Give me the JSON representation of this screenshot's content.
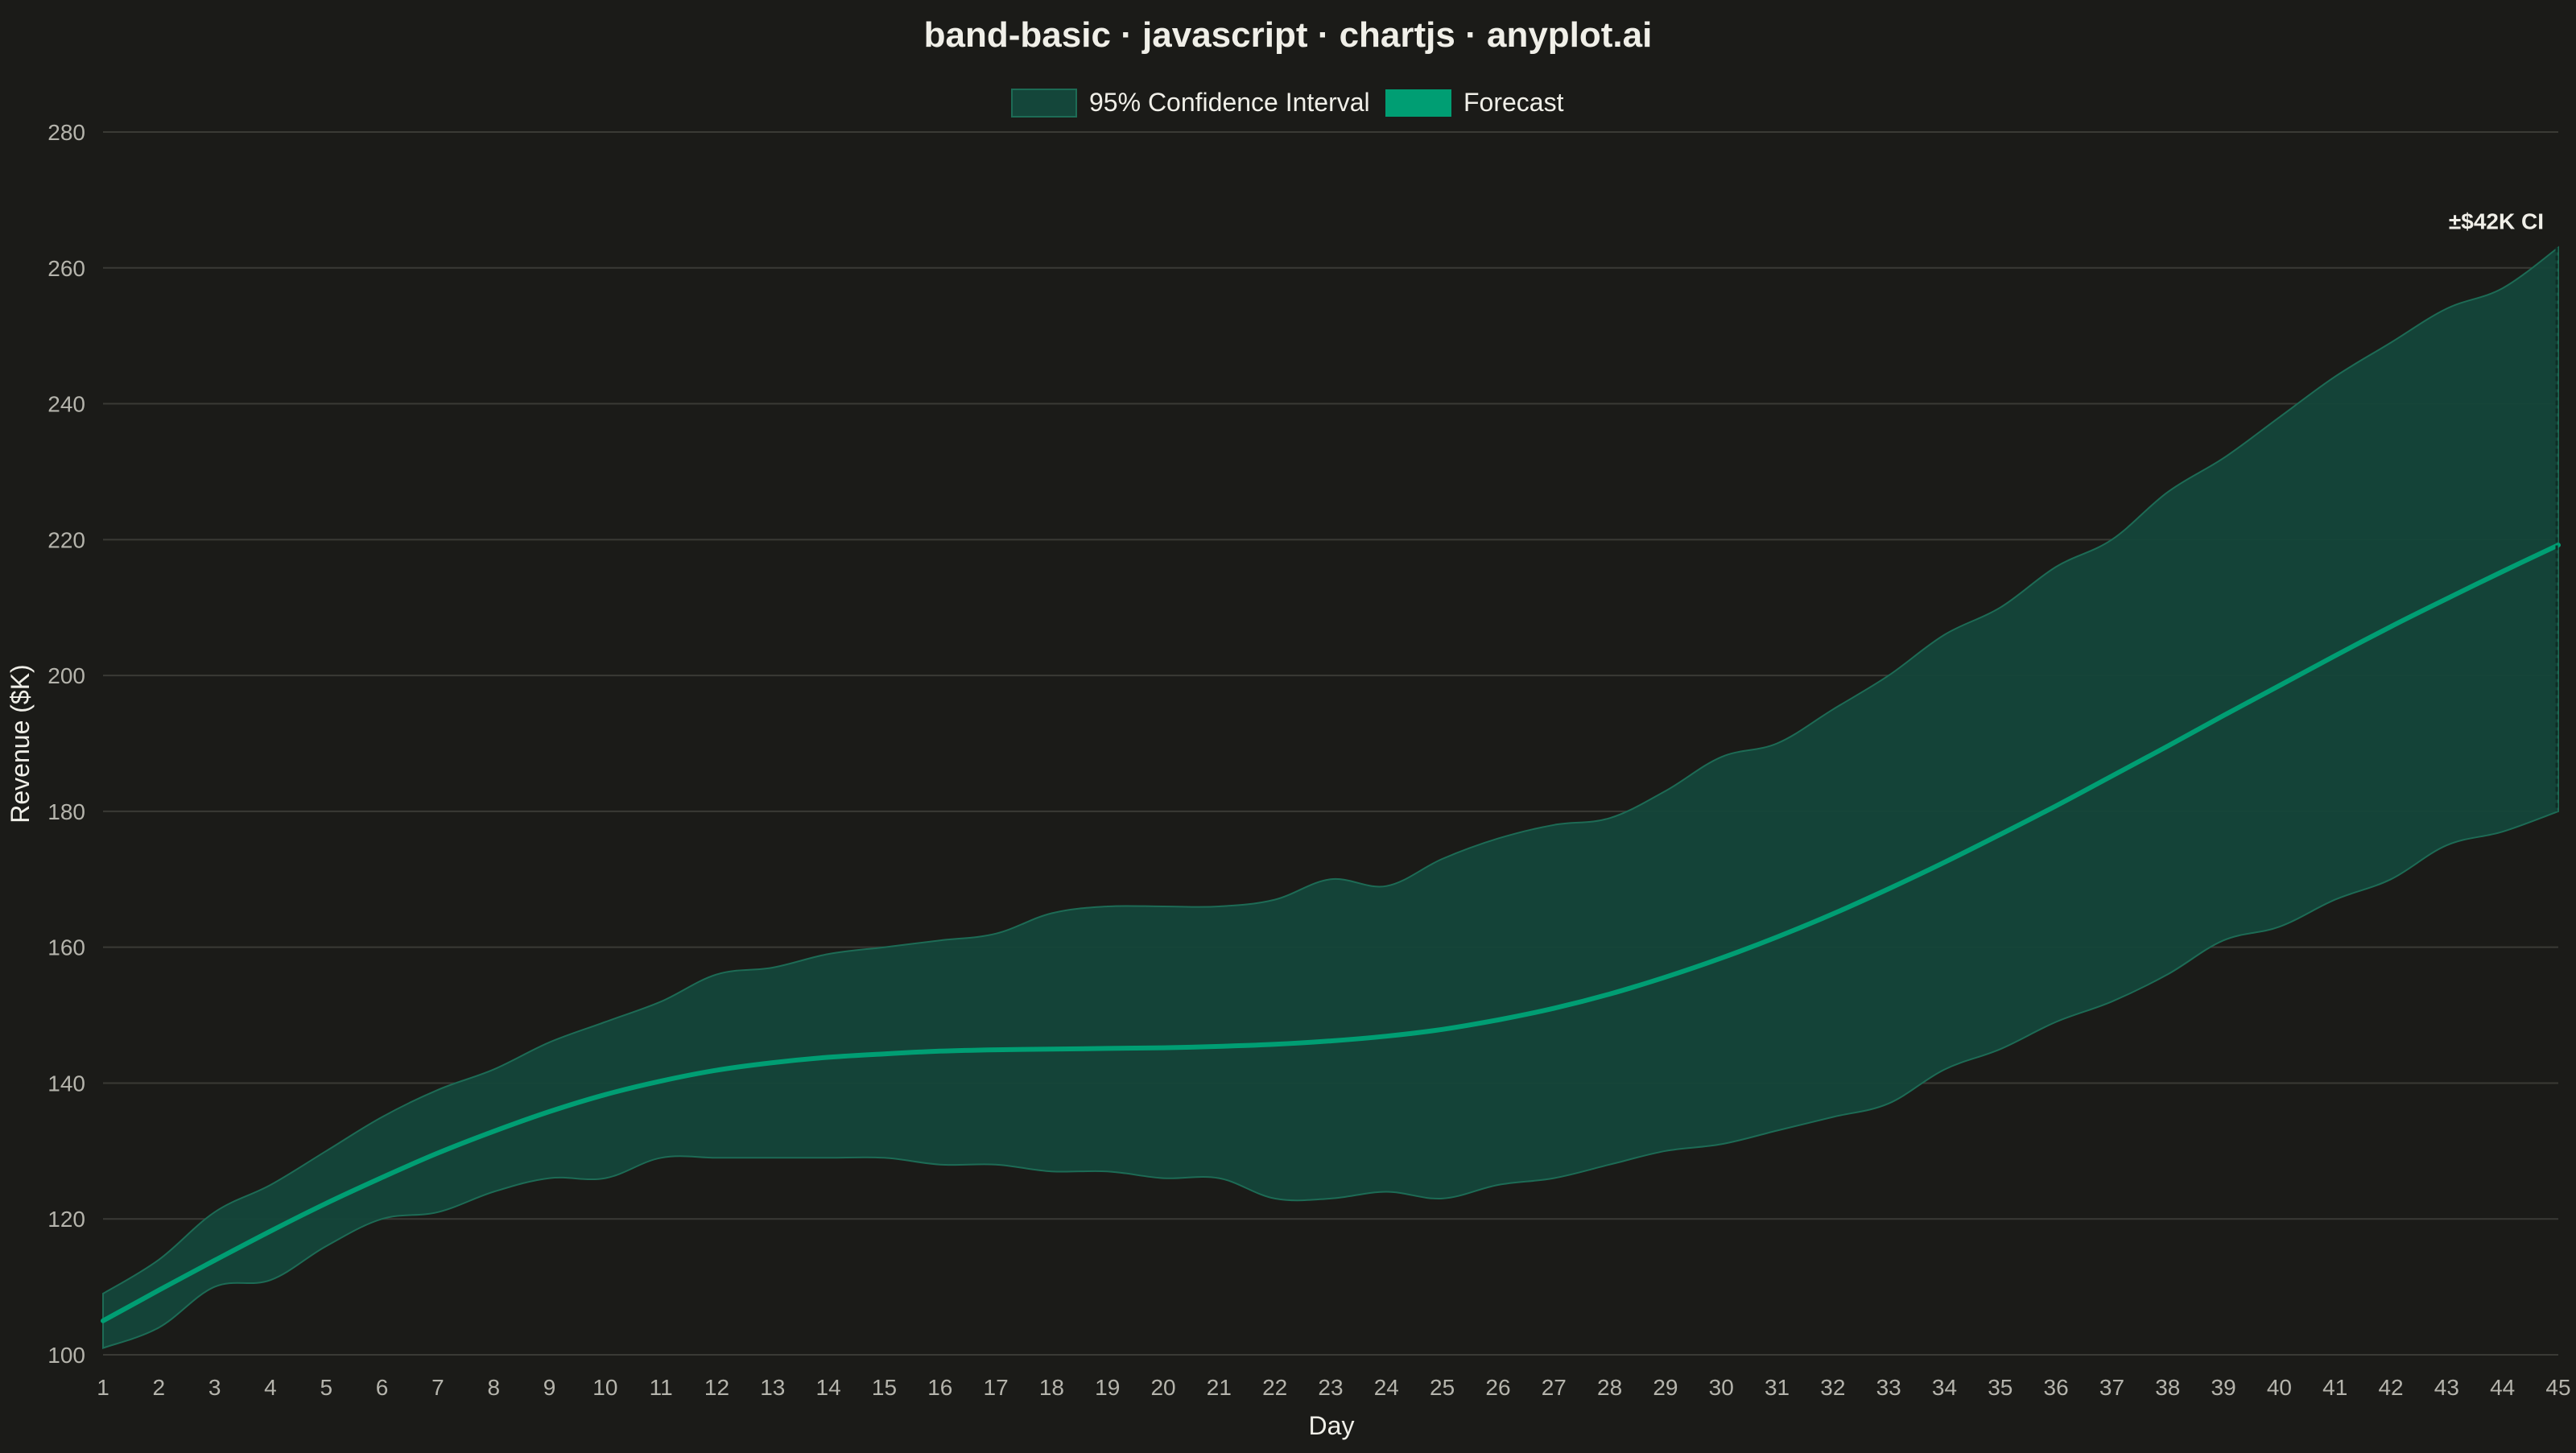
{
  "chart_data": {
    "type": "area",
    "title": "band-basic · javascript · chartjs · anyplot.ai",
    "xlabel": "Day",
    "ylabel": "Revenue ($K)",
    "ylim": [
      100,
      280
    ],
    "yticks": [
      100,
      120,
      140,
      160,
      180,
      200,
      220,
      240,
      260,
      280
    ],
    "grid": true,
    "legend_position": "top-center",
    "x": [
      1,
      2,
      3,
      4,
      5,
      6,
      7,
      8,
      9,
      10,
      11,
      12,
      13,
      14,
      15,
      16,
      17,
      18,
      19,
      20,
      21,
      22,
      23,
      24,
      25,
      26,
      27,
      28,
      29,
      30,
      31,
      32,
      33,
      34,
      35,
      36,
      37,
      38,
      39,
      40,
      41,
      42,
      43,
      44,
      45
    ],
    "series": [
      {
        "name": "95% Confidence Interval",
        "kind": "band",
        "upper": [
          109,
          114,
          121,
          125,
          130,
          135,
          139,
          142,
          146,
          149,
          152,
          156,
          157,
          159,
          160,
          161,
          162,
          165,
          166,
          166,
          166,
          167,
          170,
          169,
          173,
          176,
          178,
          179,
          183,
          188,
          190,
          195,
          200,
          206,
          210,
          216,
          220,
          227,
          232,
          238,
          244,
          249,
          254,
          257,
          263
        ],
        "lower": [
          101,
          104,
          110,
          111,
          116,
          120,
          121,
          124,
          126,
          126,
          129,
          129,
          129,
          129,
          129,
          128,
          128,
          127,
          127,
          126,
          126,
          123,
          123,
          124,
          123,
          125,
          126,
          128,
          130,
          131,
          133,
          135,
          137,
          142,
          145,
          149,
          152,
          156,
          161,
          163,
          167,
          170,
          175,
          177,
          180
        ],
        "color": "#14463a"
      },
      {
        "name": "Forecast",
        "kind": "line",
        "values": [
          105,
          109.5,
          113.9,
          118.2,
          122.3,
          126.1,
          129.7,
          132.9,
          135.8,
          138.3,
          140.3,
          141.9,
          143,
          143.8,
          144.3,
          144.7,
          144.9,
          145,
          145.1,
          145.2,
          145.4,
          145.7,
          146.2,
          146.9,
          147.9,
          149.3,
          151,
          153.1,
          155.6,
          158.4,
          161.5,
          164.9,
          168.6,
          172.5,
          176.6,
          180.8,
          185.2,
          189.6,
          194.1,
          198.5,
          202.9,
          207.2,
          211.3,
          215.3,
          219.2
        ],
        "color": "#009e73"
      }
    ],
    "annotations": [
      {
        "text": "±$42K CI",
        "x": 45,
        "y": 265
      }
    ]
  }
}
